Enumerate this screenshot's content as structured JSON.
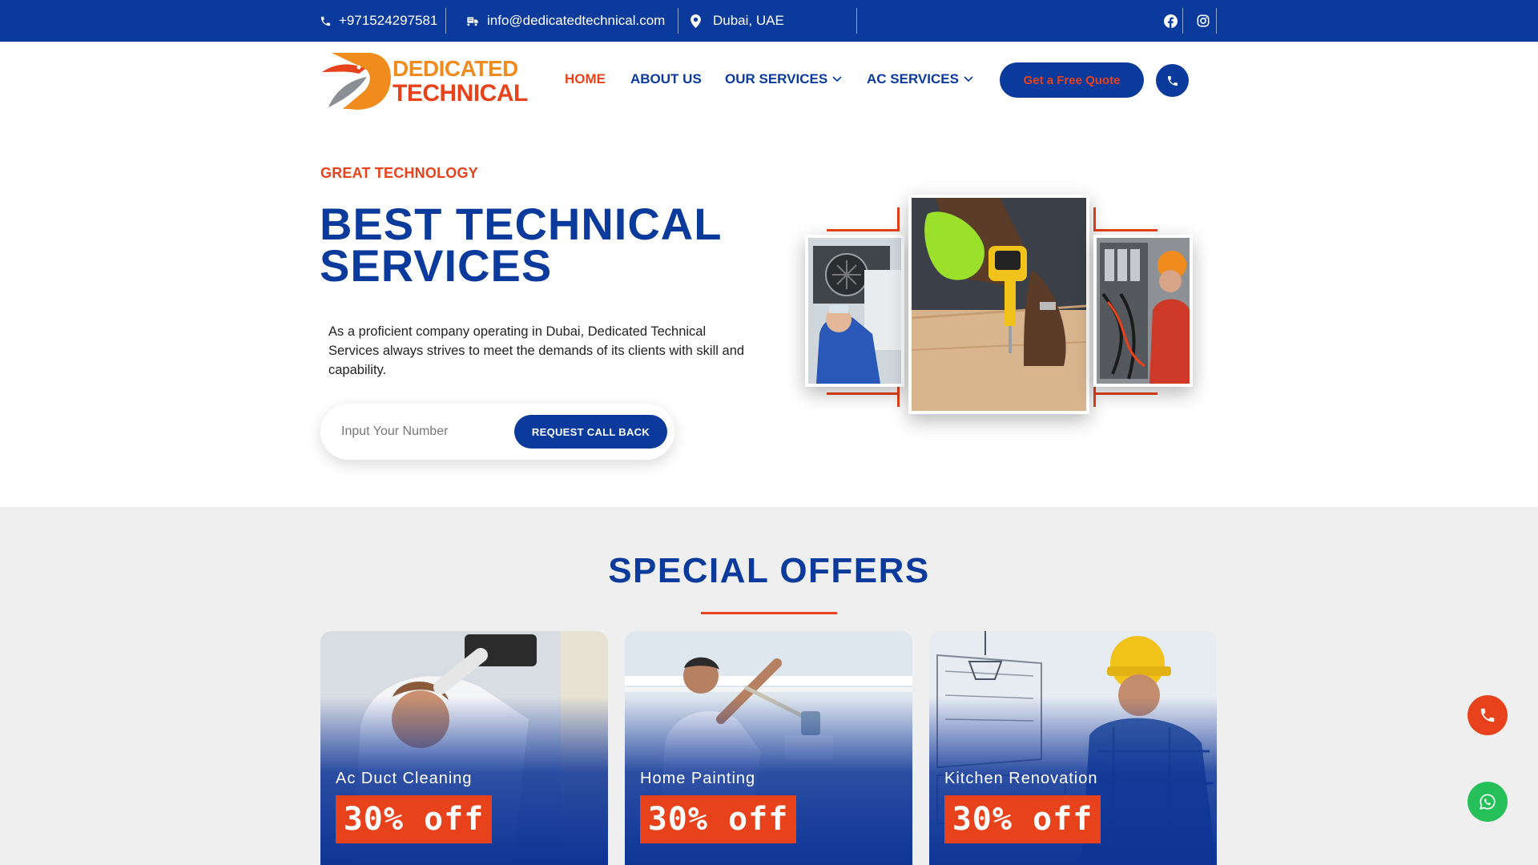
{
  "topbar": {
    "phone": "+971524297581",
    "email": "info@dedicatedtechnical.com",
    "location": "Dubai, UAE",
    "social_icons": [
      "facebook-icon",
      "instagram-icon"
    ]
  },
  "brand": {
    "line1": "DEDICATED",
    "line2": "TECHNICAL",
    "colors": {
      "orange": "#f08b1d",
      "red": "#e8421c"
    }
  },
  "nav": {
    "items": [
      {
        "label": "HOME",
        "active": true
      },
      {
        "label": "ABOUT US"
      },
      {
        "label": "OUR SERVICES",
        "dropdown": true
      },
      {
        "label": "AC SERVICES",
        "dropdown": true
      }
    ],
    "cta": "Get a Free Quote",
    "call_icon": "phone-icon"
  },
  "hero": {
    "eyebrow": "GREAT TECHNOLOGY",
    "title_line1": "BEST TECHNICAL",
    "title_line2": "SERVICES",
    "description": "As a proficient company operating in Dubai, Dedicated Technical Services always strives to meet the demands of its clients with skill and capability.",
    "input_placeholder": "Input Your Number",
    "button": "REQUEST CALL BACK"
  },
  "offers": {
    "title": "SPECIAL OFFERS",
    "cards": [
      {
        "name": "Ac Duct Cleaning",
        "discount": "30% off"
      },
      {
        "name": "Home Painting",
        "discount": "30% off"
      },
      {
        "name": "Kitchen Renovation",
        "discount": "30% off"
      }
    ]
  },
  "floating": {
    "call_icon": "phone-icon",
    "whatsapp_icon": "whatsapp-icon"
  },
  "colors": {
    "primary": "#0a3a9c",
    "accent": "#e8421c",
    "offers_bg": "#efefef",
    "whatsapp": "#25c05a"
  }
}
